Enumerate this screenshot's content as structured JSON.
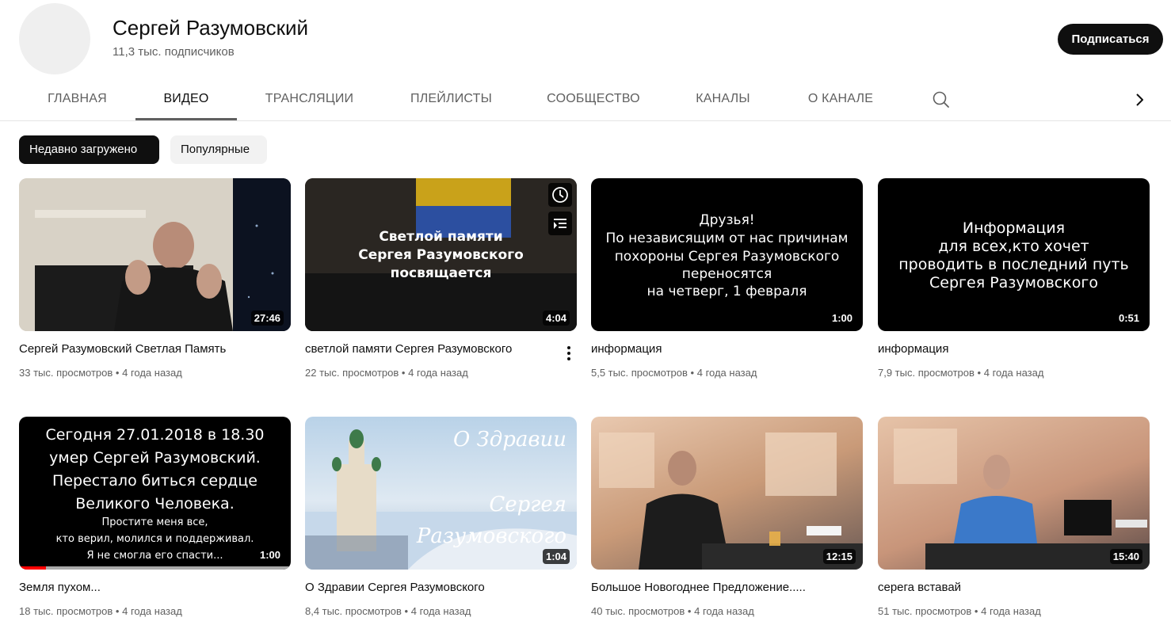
{
  "channel": {
    "name": "Сергей Разумовский",
    "subscribers": "11,3 тыс. подписчиков",
    "subscribe_label": "Подписаться"
  },
  "tabs": [
    {
      "label": "ГЛАВНАЯ"
    },
    {
      "label": "ВИДЕО",
      "active": true
    },
    {
      "label": "ТРАНСЛЯЦИИ"
    },
    {
      "label": "ПЛЕЙЛИСТЫ"
    },
    {
      "label": "СООБЩЕСТВО"
    },
    {
      "label": "КАНАЛЫ"
    },
    {
      "label": "О КАНАЛЕ"
    }
  ],
  "filters": {
    "recent": "Недавно загружено",
    "popular": "Популярные"
  },
  "videos": [
    {
      "title": "Сергей Разумовский Светлая Память",
      "views": "33 тыс. просмотров",
      "age": "4 года назад",
      "duration": "27:46"
    },
    {
      "title": "светлой памяти Сергея Разумовского",
      "views": "22 тыс. просмотров",
      "age": "4 года назад",
      "duration": "4:04",
      "thumb_lines": [
        "Светлой памяти",
        "Сергея Разумовского",
        "посвящается"
      ]
    },
    {
      "title": "информация",
      "views": "5,5 тыс. просмотров",
      "age": "4 года назад",
      "duration": "1:00",
      "thumb_lines": [
        "Друзья!",
        "По независящим от нас причинам",
        "похороны Сергея Разумовского",
        "переносятся",
        "на четверг, 1 февраля"
      ]
    },
    {
      "title": "информация",
      "views": "7,9 тыс. просмотров",
      "age": "4 года назад",
      "duration": "0:51",
      "thumb_lines": [
        "Информация",
        "для всех,кто хочет",
        "проводить в последний путь",
        "Сергея Разумовского"
      ]
    },
    {
      "title": "Земля пухом...",
      "views": "18 тыс. просмотров",
      "age": "4 года назад",
      "duration": "1:00",
      "thumb_lines": [
        "Сегодня 27.01.2018 в 18.30",
        "умер Сергей Разумовский.",
        "Перестало биться сердце",
        "Великого Человека."
      ],
      "thumb_small_lines": [
        "Простите меня все,",
        "кто верил, молился и поддерживал.",
        "Я не смогла его спасти..."
      ],
      "watched_fraction": 0.1
    },
    {
      "title": "О Здравии Сергея Разумовского",
      "views": "8,4 тыс. просмотров",
      "age": "4 года назад",
      "duration": "1:04",
      "thumb_lines": [
        "О Здравии",
        "Сергея",
        "Разумовского"
      ]
    },
    {
      "title": "Большое Новогоднее Предложение.....",
      "views": "40 тыс. просмотров",
      "age": "4 года назад",
      "duration": "12:15"
    },
    {
      "title": "серега вставай",
      "views": "51 тыс. просмотров",
      "age": "4 года назад",
      "duration": "15:40"
    }
  ],
  "meta_separator": "•",
  "icons": {
    "search": "search-icon",
    "next": "chevron-right-icon",
    "watch_later": "clock-icon",
    "add_to_queue": "queue-icon",
    "more": "more-vert-icon"
  },
  "colors": {
    "subscribe_bg": "#0f0f0f",
    "active_chip_bg": "#0f0f0f",
    "progress": "#ff0000"
  }
}
